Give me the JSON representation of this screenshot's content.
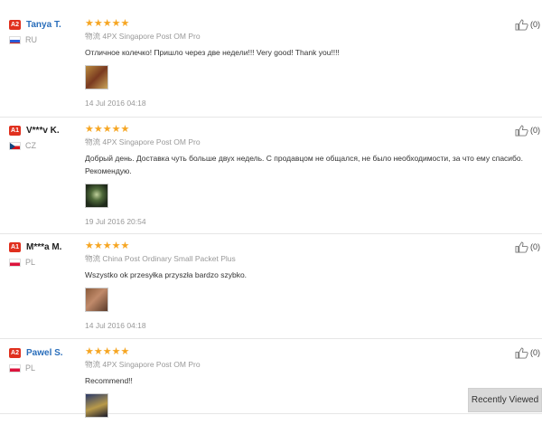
{
  "reviews": [
    {
      "level": "A2",
      "name": "Tanya T.",
      "country": "RU",
      "stars": "★★★★★",
      "shipping": "物流 4PX Singapore Post OM Pro",
      "text": "Отличное колечко! Пришло через две недели!!! Very good! Thank you!!!!",
      "date": "14 Jul 2016 04:18",
      "likes": "(0)"
    },
    {
      "level": "A1",
      "name": "V***v K.",
      "country": "CZ",
      "stars": "★★★★★",
      "shipping": "物流 4PX Singapore Post OM Pro",
      "text": "Добрый день. Доставка чуть больше двух недель. С продавцом не общался, не было необходимости, за что ему спасибо. Рекомендую.",
      "date": "19 Jul 2016 20:54",
      "likes": "(0)"
    },
    {
      "level": "A1",
      "name": "M***a M.",
      "country": "PL",
      "stars": "★★★★★",
      "shipping": "物流 China Post Ordinary Small Packet Plus",
      "text": "Wszystko ok przesyłka przyszła bardzo szybko.",
      "date": "14 Jul 2016 04:18",
      "likes": "(0)"
    },
    {
      "level": "A2",
      "name": "Pawel S.",
      "country": "PL",
      "stars": "★★★★★",
      "shipping": "物流 4PX Singapore Post OM Pro",
      "text": "Recommend!!",
      "date": "",
      "likes": "(0)"
    }
  ],
  "recently_viewed": "Recently Viewed",
  "colors": {
    "star": "#f6a623",
    "level_badge": "#e0301e",
    "link_name": "#2a6ebb"
  }
}
